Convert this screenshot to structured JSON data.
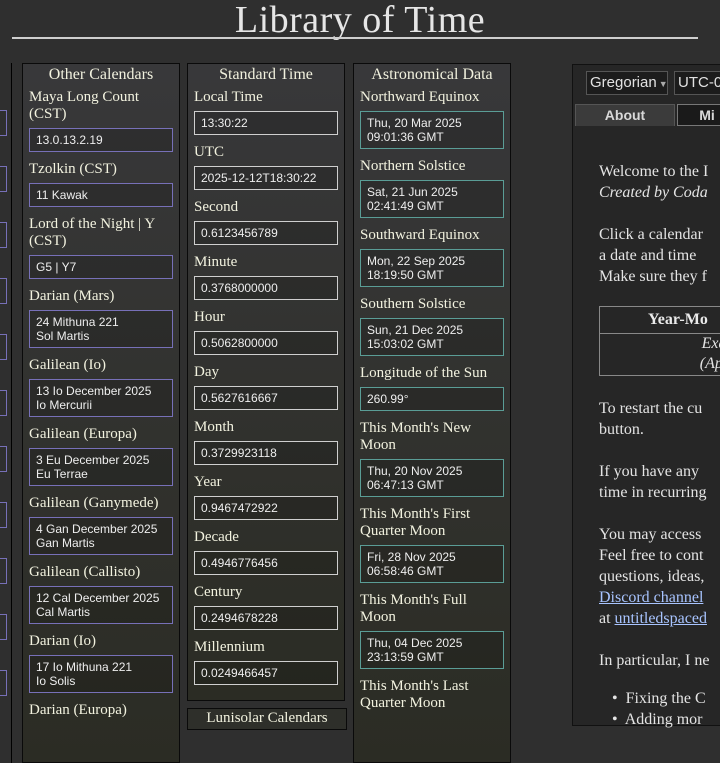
{
  "title": "Library of Time",
  "other_calendars": {
    "title": "Other Calendars",
    "entries": [
      {
        "label": "Maya Long Count (CST)",
        "value": "13.0.13.2.19"
      },
      {
        "label": "Tzolkin (CST)",
        "value": "11 Kawak"
      },
      {
        "label": "Lord of the Night | Y (CST)",
        "value": "G5 | Y7"
      },
      {
        "label": "Darian (Mars)",
        "value": "24 Mithuna 221",
        "value2": "Sol Martis"
      },
      {
        "label": "Galilean (Io)",
        "value": "13 Io December 2025",
        "value2": "Io Mercurii"
      },
      {
        "label": "Galilean (Europa)",
        "value": "3 Eu December 2025",
        "value2": "Eu Terrae"
      },
      {
        "label": "Galilean (Ganymede)",
        "value": "4 Gan December 2025",
        "value2": "Gan Martis"
      },
      {
        "label": "Galilean (Callisto)",
        "value": "12 Cal December 2025",
        "value2": "Cal Martis"
      },
      {
        "label": "Darian (Io)",
        "value": "17 Io Mithuna 221",
        "value2": "Io Solis"
      },
      {
        "label": "Darian (Europa)"
      }
    ]
  },
  "standard_time": {
    "title": "Standard Time",
    "entries": [
      {
        "label": "Local Time",
        "value": "13:30:22"
      },
      {
        "label": "UTC",
        "value": "2025-12-12T18:30:22"
      },
      {
        "label": "Second",
        "value": "0.6123456789"
      },
      {
        "label": "Minute",
        "value": "0.3768000000"
      },
      {
        "label": "Hour",
        "value": "0.5062800000"
      },
      {
        "label": "Day",
        "value": "0.5627616667"
      },
      {
        "label": "Month",
        "value": "0.3729923118"
      },
      {
        "label": "Year",
        "value": "0.9467472922"
      },
      {
        "label": "Decade",
        "value": "0.4946776456"
      },
      {
        "label": "Century",
        "value": "0.2494678228"
      },
      {
        "label": "Millennium",
        "value": "0.0249466457"
      }
    ]
  },
  "lunisolar": {
    "title": "Lunisolar Calendars"
  },
  "astronomical": {
    "title": "Astronomical Data",
    "entries": [
      {
        "label": "Northward Equinox",
        "value": "Thu, 20 Mar 2025",
        "value2": "09:01:36 GMT"
      },
      {
        "label": "Northern Solstice",
        "value": "Sat, 21 Jun 2025",
        "value2": "02:41:49 GMT"
      },
      {
        "label": "Southward Equinox",
        "value": "Mon, 22 Sep 2025",
        "value2": "18:19:50 GMT"
      },
      {
        "label": "Southern Solstice",
        "value": "Sun, 21 Dec 2025",
        "value2": "15:03:02 GMT"
      },
      {
        "label": "Longitude of the Sun",
        "value": "260.99°"
      },
      {
        "label": "This Month's New Moon",
        "value": "Thu, 20 Nov 2025",
        "value2": "06:47:13 GMT"
      },
      {
        "label": "This Month's First Quarter Moon",
        "value": "Fri, 28 Nov 2025",
        "value2": "06:58:46 GMT"
      },
      {
        "label": "This Month's Full Moon",
        "value": "Thu, 04 Dec 2025",
        "value2": "23:13:59 GMT"
      },
      {
        "label": "This Month's Last Quarter Moon"
      }
    ]
  },
  "controls": {
    "calendar_select": "Gregorian",
    "timezone_select": "UTC-0",
    "tabs": [
      "About",
      "Mi"
    ]
  },
  "about": {
    "welcome": "Welcome to the I",
    "created": "Created by Coda",
    "click1": "Click a calendar",
    "click2": "a date and time",
    "click3": "Make sure they f",
    "example_head": "Year-Mo",
    "example_line1": "Exam",
    "example_line2": "(April",
    "restart1": "To restart the cu",
    "restart2": "button.",
    "haveany1": "If you have any",
    "haveany2": "time in recurring",
    "access1": "You may access",
    "access2": "Feel free to cont",
    "access3": "questions, ideas,",
    "discord": "Discord channel",
    "at_word": "at",
    "untitled": "untitledspaced",
    "particular": "In particular, I ne",
    "bullet1": "Fixing the C",
    "bullet2": "Adding mor"
  },
  "colors": {
    "background": "#2f2f2f",
    "other_border": "#7770b8",
    "standard_border": "#cfcfcf",
    "astro_border": "#5a9d96",
    "link": "#a8c4ff"
  }
}
